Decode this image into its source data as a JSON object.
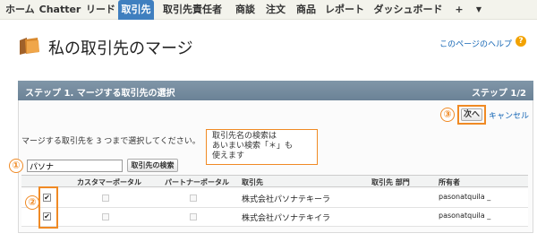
{
  "nav": {
    "tabs": [
      "ホーム",
      "Chatter",
      "リード",
      "取引先",
      "取引先責任者",
      "商談",
      "注文",
      "商品",
      "レポート",
      "ダッシュボード"
    ],
    "active_tab": "取引先",
    "plus": "+",
    "dropdown": "▼"
  },
  "header": {
    "title": "私の取引先のマージ",
    "help_link": "このページのヘルプ",
    "help_icon": "?"
  },
  "step": {
    "title": "ステップ 1. マージする取引先の選択",
    "count": "ステップ 1/2"
  },
  "actions": {
    "next": "次へ",
    "cancel": "キャンセル"
  },
  "instruction": "マージする取引先を 3 つまで選択してください。",
  "tooltip": {
    "lines": [
      "取引先名の検索は",
      "あいまい検索「＊」も",
      "使えます"
    ]
  },
  "search": {
    "value": "パソナ",
    "button": "取引先の検索"
  },
  "callouts": [
    "①",
    "②",
    "③"
  ],
  "table": {
    "columns": [
      "カスタマーポータル",
      "パートナーポータル",
      "取引先",
      "取引先 部門",
      "所有者"
    ],
    "rows": [
      {
        "checked": "✔",
        "account": "株式会社パソナテキーラ",
        "division": "",
        "owner": "pasonatquila _"
      },
      {
        "checked": "✔",
        "account": "株式会社パソナテキイラ",
        "division": "",
        "owner": "pasonatquila _"
      }
    ]
  },
  "colors": {
    "active_tab": "#3f7fbf",
    "step_bar": "#7388a0",
    "callout": "#f08a24",
    "link": "#1566b5"
  },
  "icons": {
    "folder": "folder-icon",
    "help": "help-icon",
    "dropdown": "chevron-down-icon"
  }
}
